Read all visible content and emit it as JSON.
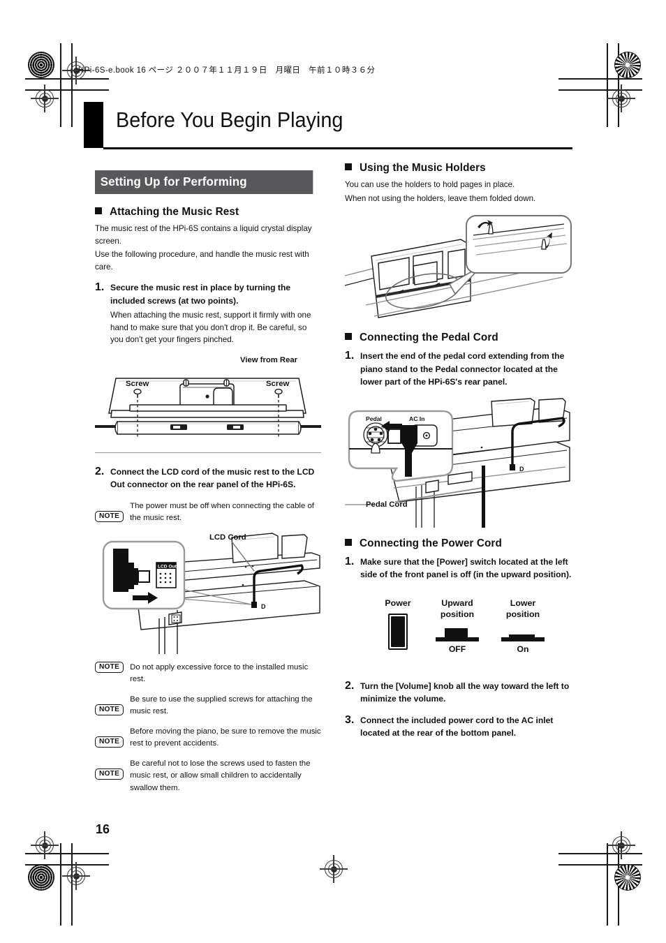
{
  "page": {
    "file_header": "HPi-6S-e.book  16 ページ  ２００７年１１月１９日　月曜日　午前１０時３６分",
    "chapter_title": "Before You Begin Playing",
    "page_number": "16"
  },
  "left_column": {
    "section_bar": "Setting Up for Performing",
    "attaching": {
      "heading": "Attaching the Music Rest",
      "intro_line1": "The music rest of the HPi-6S contains a liquid crystal display screen.",
      "intro_line2": "Use the following procedure, and handle the music rest with care.",
      "step1": {
        "num": "1.",
        "title": "Secure the music rest in place by turning the included screws (at two points).",
        "detail": "When attaching the music rest, support it firmly with one hand to make sure that you don't drop it. Be careful, so you don't get your fingers pinched."
      },
      "figure1": {
        "caption": "View from Rear",
        "label_left": "Screw",
        "label_right": "Screw"
      },
      "step2": {
        "num": "2.",
        "title": "Connect the LCD cord of the music rest to the LCD Out connector on the rear panel of the HPi-6S.",
        "note": "The power must be off when connecting the cable of the music rest."
      },
      "figure2": {
        "label_cord": "LCD Cord",
        "label_connector": "LCD Out"
      },
      "notes": [
        "Do not apply excessive force to the installed music rest.",
        "Be sure to use the supplied screws for attaching the music rest.",
        "Before moving the piano, be sure to remove the music rest to prevent accidents.",
        "Be careful not to lose the screws used to fasten the music rest, or allow small children to accidentally swallow them."
      ],
      "note_badge_label": "NOTE"
    }
  },
  "right_column": {
    "music_holders": {
      "heading": "Using the Music Holders",
      "line1": "You can use the holders to hold pages in place.",
      "line2": "When not using the holders, leave them folded down."
    },
    "pedal_cord": {
      "heading": "Connecting the Pedal Cord",
      "step1": {
        "num": "1.",
        "title": "Insert the end of the pedal cord extending from the piano stand to the Pedal connector located at the lower part of the HPi-6S's rear panel."
      },
      "figure": {
        "label_pedal_jack": "Pedal",
        "label_ac_in": "AC In",
        "label_pedal_cord": "Pedal Cord"
      }
    },
    "power_cord": {
      "heading": "Connecting the Power Cord",
      "step1": {
        "num": "1.",
        "title": "Make sure that the [Power] switch located at the left side of the front panel is off (in the upward position)."
      },
      "figure": {
        "label_power": "Power",
        "label_upward": "Upward\nposition",
        "label_upward_l1": "Upward",
        "label_upward_l2": "position",
        "label_lower_l1": "Lower",
        "label_lower_l2": "position",
        "state_off": "OFF",
        "state_on": "On"
      },
      "step2": {
        "num": "2.",
        "title": "Turn the [Volume] knob all the way toward the left to minimize the volume."
      },
      "step3": {
        "num": "3.",
        "title": "Connect the included power cord to the AC inlet located at the rear of the bottom panel."
      }
    }
  },
  "colors": {
    "bar_background": "#58585a",
    "text": "#111111",
    "rule": "#9a9a9a"
  }
}
